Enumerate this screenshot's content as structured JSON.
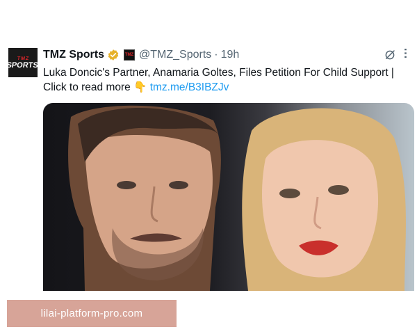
{
  "tweet": {
    "avatar_lines": [
      "TMZ",
      "SPORTS"
    ],
    "author_name": "TMZ Sports",
    "handle": "@TMZ_Sports",
    "separator": "·",
    "time": "19h",
    "text": "Luka Doncic's Partner, Anamaria Goltes, Files Petition For Child Support  |  Click to read more",
    "pointer_emoji": "👇",
    "link": "tmz.me/B3IBZJv",
    "icons": {
      "verified": "verified-badge-icon",
      "affiliate": "tmz-affiliate-badge-icon",
      "grok": "grok-icon",
      "more": "more-options-icon"
    },
    "colors": {
      "link": "#1d9bf0",
      "verified": "#e6b12a",
      "secondary_text": "#536471"
    }
  },
  "media": {
    "description": "photo"
  },
  "watermark": {
    "text": "lilai-platform-pro.com",
    "background": "#d7a498"
  }
}
